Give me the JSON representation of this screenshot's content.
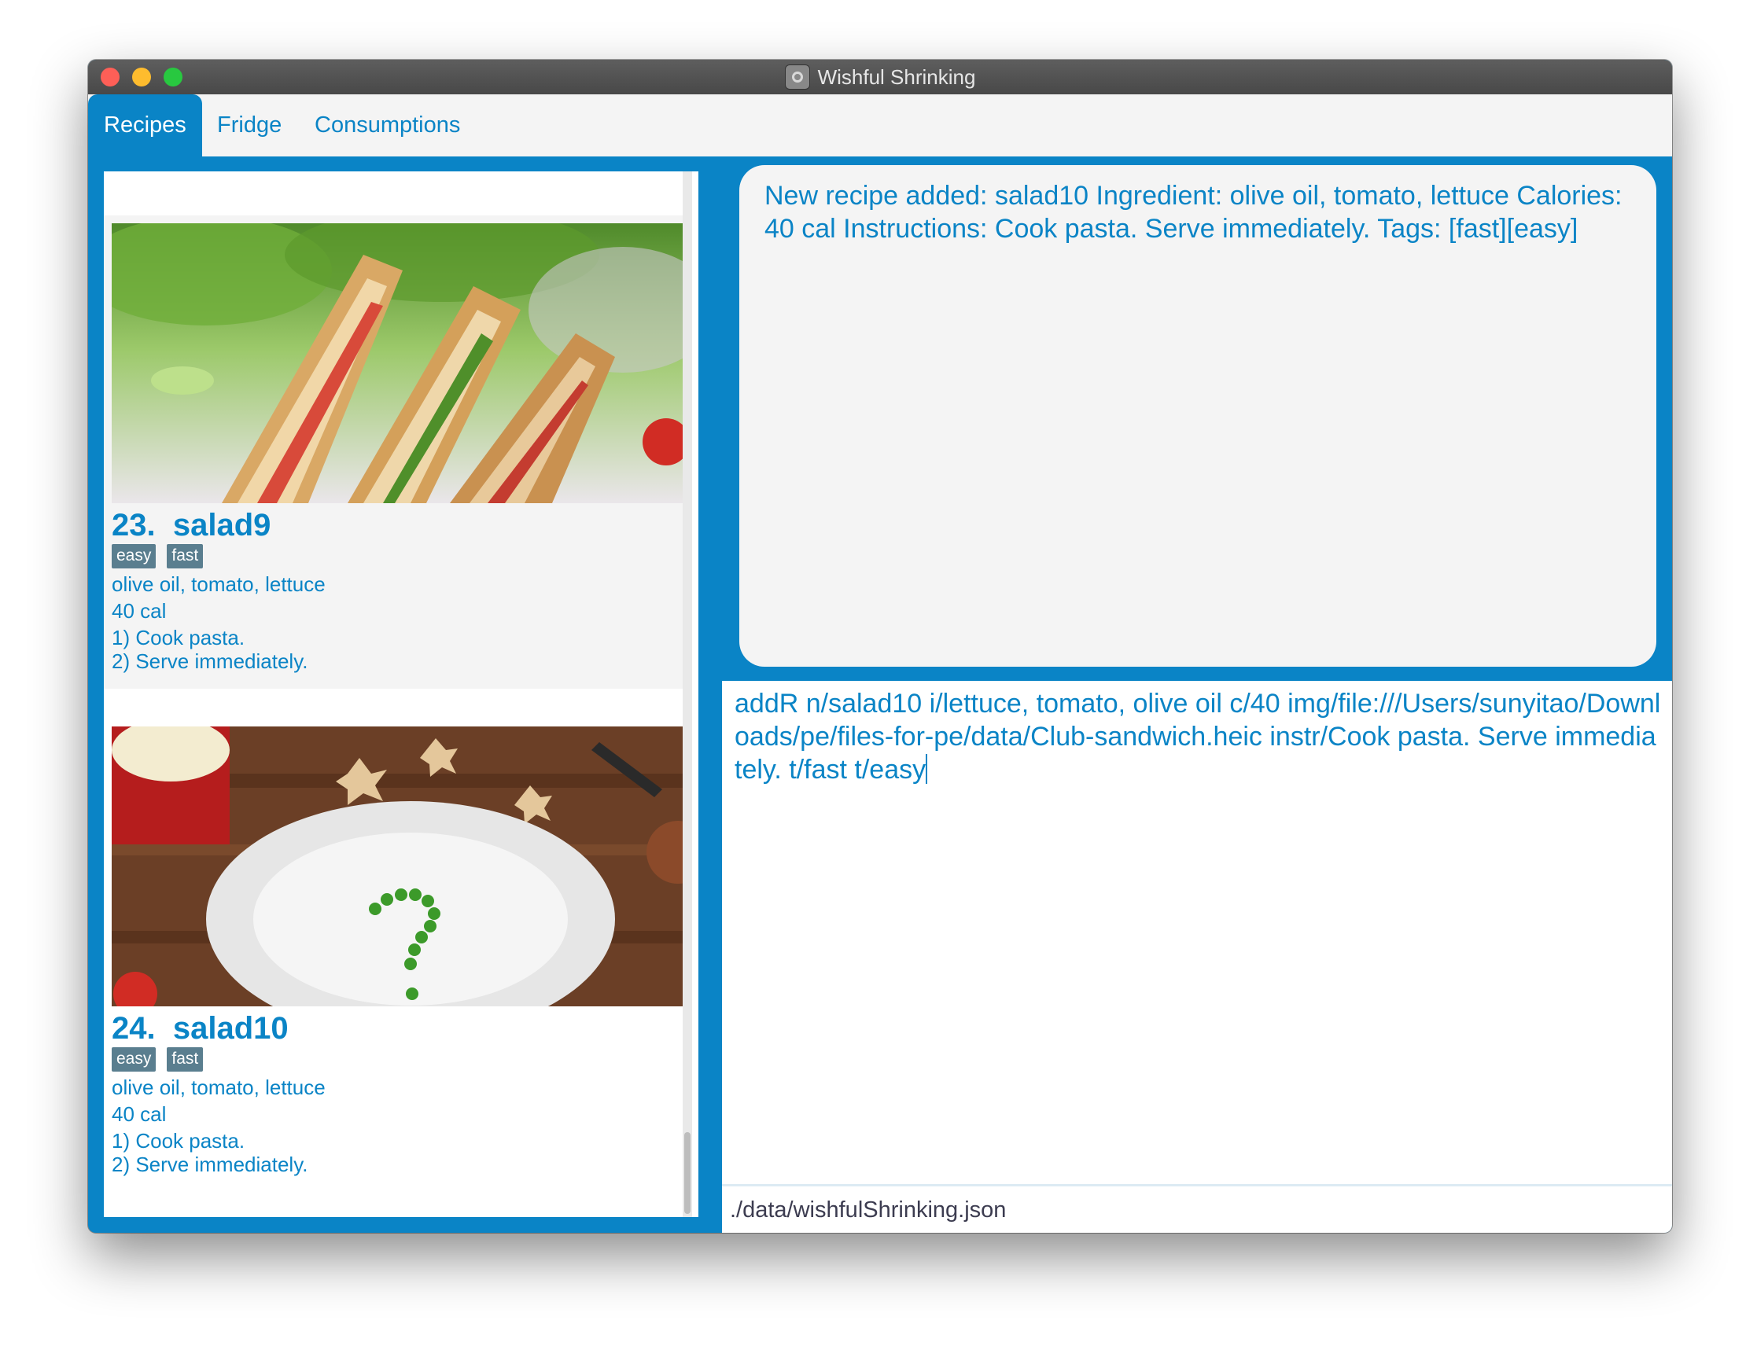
{
  "window": {
    "title": "Wishful Shrinking",
    "app_icon": "app-icon"
  },
  "tabs": [
    {
      "label": "Recipes",
      "active": true
    },
    {
      "label": "Fridge",
      "active": false
    },
    {
      "label": "Consumptions",
      "active": false
    }
  ],
  "recipes": [
    {
      "index": "23.",
      "name": "salad9",
      "tags": [
        "easy",
        "fast"
      ],
      "ingredients": " olive oil,  tomato,  lettuce",
      "calories": "40 cal",
      "steps": [
        "1) Cook pasta.",
        "2) Serve immediately."
      ],
      "image": "club-sandwich-photo"
    },
    {
      "index": "24.",
      "name": "salad10",
      "tags": [
        "easy",
        "fast"
      ],
      "ingredients": " olive oil,  tomato,  lettuce",
      "calories": "40 cal",
      "steps": [
        "1) Cook pasta.",
        "2) Serve immediately."
      ],
      "image": "plate-with-peas-question-mark-photo"
    }
  ],
  "result_display": {
    "text": "New recipe added: salad10 Ingredient:  olive oil,  tomato,  lettuce Calories: 40 cal Instructions: Cook pasta.  Serve immediately. Tags: [fast][easy]"
  },
  "command_box": {
    "value": "addR n/salad10 i/lettuce, tomato, olive oil c/40 img/file:///Users/sunyitao/Downloads/pe/files-for-pe/data/Club-sandwich.heic instr/Cook pasta. Serve immediately. t/fast t/easy"
  },
  "status_bar": {
    "path": "./data/wishfulShrinking.json"
  },
  "colors": {
    "accent": "#0a84c6",
    "tag": "#5a7e8f",
    "panel": "#f4f4f4"
  }
}
